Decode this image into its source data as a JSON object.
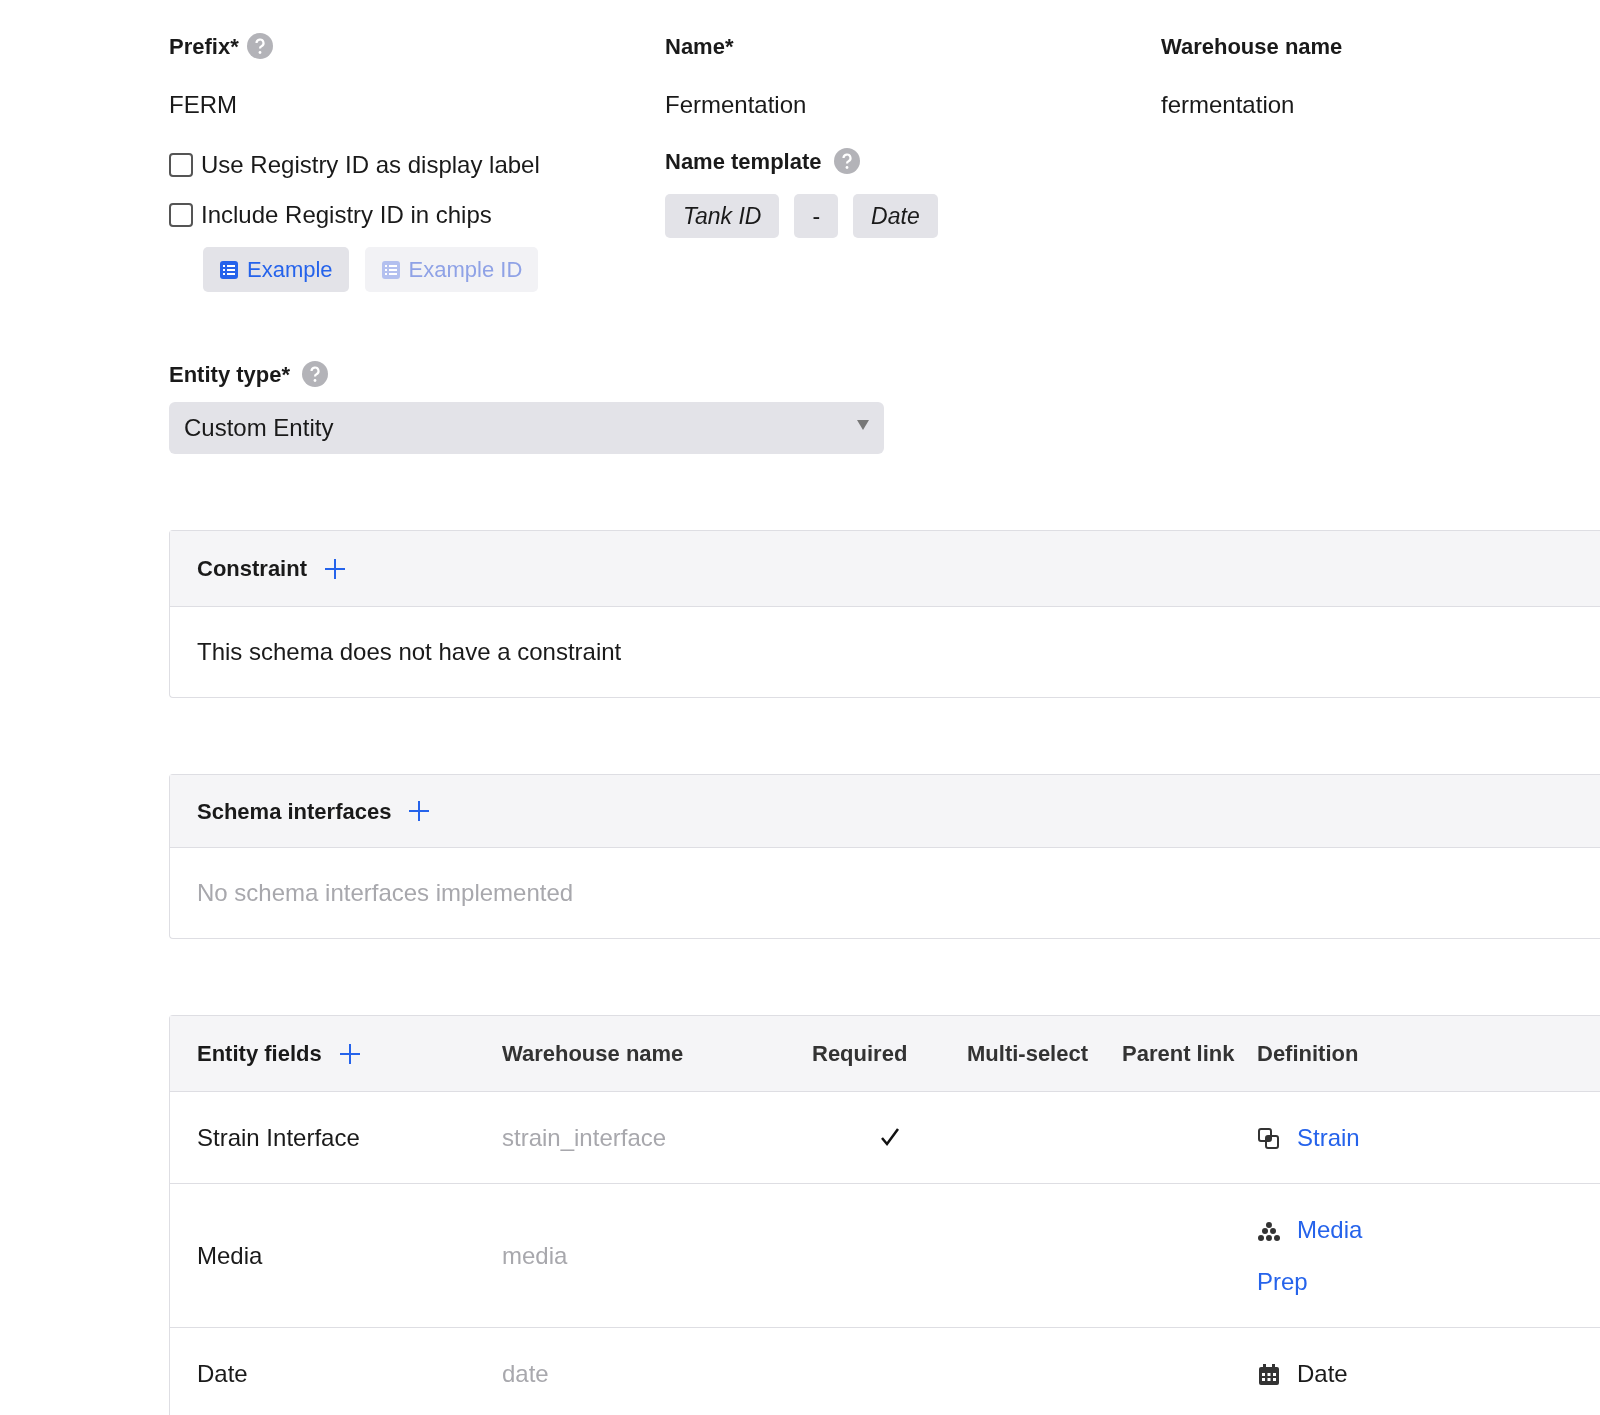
{
  "fields_top": [
    {
      "label": "Prefix*",
      "help": true,
      "value": "FERM"
    },
    {
      "label": "Name*",
      "help": false,
      "value": "Fermentation"
    },
    {
      "label": "Warehouse name",
      "help": false,
      "value": "fermentation"
    }
  ],
  "options": [
    {
      "label": "Use Registry ID as display label",
      "checked": false
    },
    {
      "label": "Include Registry ID in chips",
      "checked": false
    }
  ],
  "example_chips": [
    {
      "label": "Example",
      "disabled": false
    },
    {
      "label": "Example ID",
      "disabled": true
    }
  ],
  "name_template": {
    "label": "Name template",
    "parts": [
      {
        "text": "Tank ID",
        "italic": true
      },
      {
        "text": "-",
        "italic": false
      },
      {
        "text": "Date",
        "italic": true
      }
    ]
  },
  "entity_type": {
    "label": "Entity type*",
    "value": "Custom Entity"
  },
  "constraint": {
    "title": "Constraint",
    "message": "This schema does not have a constraint",
    "muted": false
  },
  "schema_interfaces": {
    "title": "Schema interfaces",
    "message": "No schema interfaces implemented",
    "muted": true
  },
  "entity_fields": {
    "title": "Entity fields",
    "columns": [
      "Warehouse name",
      "Required",
      "Multi-select",
      "Parent link",
      "Definition"
    ],
    "rows": [
      {
        "name": "Strain Interface",
        "warehouse_name": "strain_interface",
        "required": true,
        "multi_select": false,
        "parent_link": false,
        "definition": {
          "kind": "entity",
          "text": "Strain"
        }
      },
      {
        "name": "Media",
        "warehouse_name": "media",
        "required": false,
        "multi_select": false,
        "parent_link": false,
        "definition": {
          "kind": "batch",
          "text": "Media Prep"
        }
      },
      {
        "name": "Date",
        "warehouse_name": "date",
        "required": false,
        "multi_select": false,
        "parent_link": false,
        "definition": {
          "kind": "date",
          "text": "Date"
        }
      }
    ]
  }
}
